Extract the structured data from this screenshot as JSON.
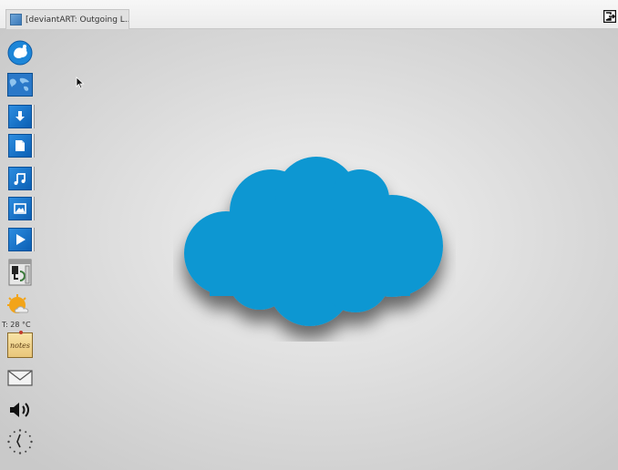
{
  "taskbar": {
    "tab_title": "[deviantART: Outgoing L..."
  },
  "dock": {
    "items": [
      {
        "name": "app-logo-icon"
      },
      {
        "name": "world-map-icon"
      },
      {
        "name": "downloads-icon"
      },
      {
        "name": "documents-icon"
      },
      {
        "name": "music-icon"
      },
      {
        "name": "pictures-icon"
      },
      {
        "name": "videos-icon"
      },
      {
        "name": "software-icon"
      },
      {
        "name": "weather-icon"
      },
      {
        "name": "notes-icon"
      },
      {
        "name": "mail-icon"
      },
      {
        "name": "volume-icon"
      },
      {
        "name": "clock-icon"
      }
    ],
    "weather_temp": "T: 28 °C",
    "notes_label": "notes"
  },
  "colors": {
    "cloud": "#0b97d2",
    "tile_blue": "#1a76cc"
  }
}
